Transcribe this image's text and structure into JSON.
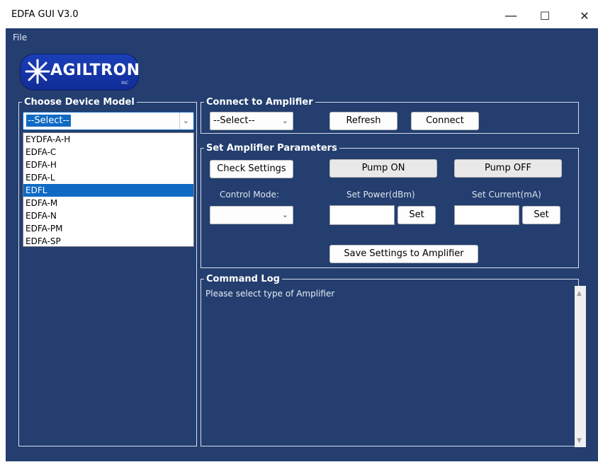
{
  "window": {
    "title": "EDFA GUI V3.0",
    "minimize": "—",
    "maximize": "☐",
    "close": "✕"
  },
  "menu": {
    "file": "File"
  },
  "logo": {
    "text": "AGILTRON",
    "inc": "INC"
  },
  "device_model": {
    "legend": "Choose Device Model",
    "selected": "--Select--",
    "options": [
      "EYDFA-A-H",
      "EDFA-C",
      "EDFA-H",
      "EDFA-L",
      "EDFL",
      "EDFA-M",
      "EDFA-N",
      "EDFA-PM",
      "EDFA-SP"
    ],
    "highlighted": "EDFL"
  },
  "connect": {
    "legend": "Connect to Amplifier",
    "port_selected": "--Select--",
    "refresh": "Refresh",
    "connect": "Connect"
  },
  "params": {
    "legend": "Set Amplifier Parameters",
    "check_settings": "Check Settings",
    "pump_on": "Pump ON",
    "pump_off": "Pump OFF",
    "control_mode_label": "Control Mode:",
    "set_power_label": "Set Power(dBm)",
    "set_current_label": "Set Current(mA)",
    "set_power_btn": "Set",
    "set_current_btn": "Set",
    "save": "Save Settings to Amplifier"
  },
  "log": {
    "legend": "Command Log",
    "text": "Please select type of Amplifier"
  },
  "colors": {
    "background": "#233e6f",
    "selection": "#0f6ac4"
  },
  "icons": {
    "chevron": "chevron-down-icon",
    "logo_star": "starburst-icon"
  }
}
